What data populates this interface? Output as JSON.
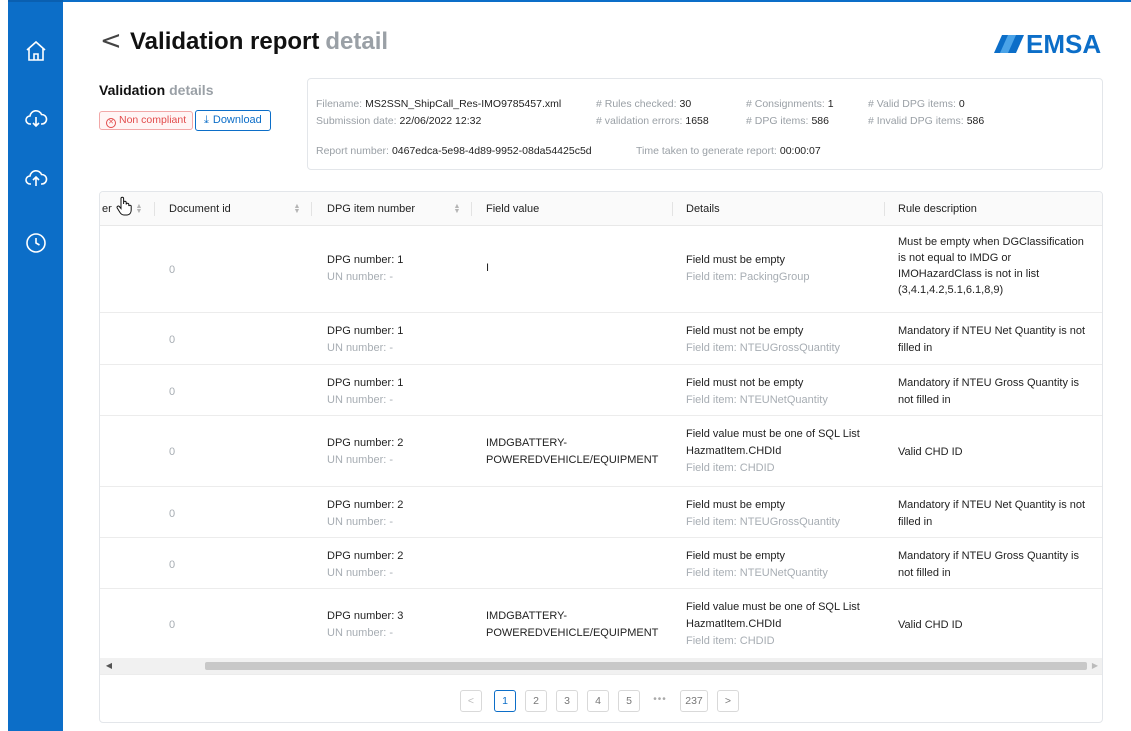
{
  "colors": {
    "brand": "#0c6ec8",
    "error": "#e24c4c",
    "muted": "#a7adb3"
  },
  "sidebar": {
    "items": [
      {
        "icon": "home-icon"
      },
      {
        "icon": "cloud-download-icon"
      },
      {
        "icon": "cloud-upload-icon"
      },
      {
        "icon": "history-icon"
      }
    ]
  },
  "header": {
    "back_icon": "chevron-left-icon",
    "title": "Validation report",
    "title_suffix": "detail",
    "logo": "EMSA"
  },
  "validation": {
    "title": "Validation",
    "title_suffix": "details",
    "status": "Non compliant",
    "status_icon": "close-circle-icon",
    "download": "Download",
    "download_icon": "download-icon"
  },
  "info": {
    "filename_label": "Filename:",
    "filename": "MS2SSN_ShipCall_Res-IMO9785457.xml",
    "submission_label": "Submission date:",
    "submission": "22/06/2022 12:32",
    "rules_label": "# Rules checked:",
    "rules": "30",
    "errors_label": "# validation errors:",
    "errors": "1658",
    "consign_label": "# Consignments:",
    "consign": "1",
    "dpg_label": "# DPG items:",
    "dpg": "586",
    "valid_label": "# Valid DPG items:",
    "valid": "0",
    "invalid_label": "# Invalid DPG items:",
    "invalid": "586",
    "report_label": "Report number:",
    "report": "0467edca-5e98-4d89-9952-08da54425c5d",
    "time_label": "Time taken to generate report:",
    "time": "00:00:07"
  },
  "table": {
    "headers": {
      "col0": "er",
      "doc": "Document id",
      "dpg": "DPG item number",
      "field": "Field value",
      "details": "Details",
      "rule": "Rule description"
    },
    "rows": [
      {
        "doc": "0",
        "dpg": "DPG number: 1",
        "un": "UN number: -",
        "field1": "I",
        "field2": "",
        "d1": "",
        "d2": "Field must be empty",
        "d3": "Field item: PackingGroup",
        "r1": "Must be empty when DGClassification",
        "r2": "is not equal to IMDG or",
        "r3": "IMOHazardClass is not in list",
        "r4": "(3,4.1,4.2,5.1,6.1,8,9)"
      },
      {
        "doc": "0",
        "dpg": "DPG number: 1",
        "un": "UN number: -",
        "field1": "",
        "field2": "",
        "d1": "",
        "d2": "Field must not be empty",
        "d3": "Field item: NTEUGrossQuantity",
        "r1": "Mandatory if NTEU Net Quantity is not",
        "r2": "filled in"
      },
      {
        "doc": "0",
        "dpg": "DPG number: 1",
        "un": "UN number: -",
        "field1": "",
        "field2": "",
        "d1": "",
        "d2": "Field must not be empty",
        "d3": "Field item: NTEUNetQuantity",
        "r1": "Mandatory if NTEU Gross Quantity is",
        "r2": "not filled in"
      },
      {
        "doc": "0",
        "dpg": "DPG number: 2",
        "un": "UN number: -",
        "field1": "IMDGBATTERY-",
        "field2": "POWEREDVEHICLE/EQUIPMENT",
        "d1": "Field value must be one of SQL List",
        "d2": "HazmatItem.CHDId",
        "d3": "Field item: CHDID",
        "r1": "Valid CHD ID",
        "r2": ""
      },
      {
        "doc": "0",
        "dpg": "DPG number: 2",
        "un": "UN number: -",
        "field1": "",
        "field2": "",
        "d1": "",
        "d2": "Field must be empty",
        "d3": "Field item: NTEUGrossQuantity",
        "r1": "Mandatory if NTEU Net Quantity is not",
        "r2": "filled in"
      },
      {
        "doc": "0",
        "dpg": "DPG number: 2",
        "un": "UN number: -",
        "field1": "",
        "field2": "",
        "d1": "",
        "d2": "Field must be empty",
        "d3": "Field item: NTEUNetQuantity",
        "r1": "Mandatory if NTEU Gross Quantity is",
        "r2": "not filled in"
      },
      {
        "doc": "0",
        "dpg": "DPG number: 3",
        "un": "UN number: -",
        "field1": "IMDGBATTERY-",
        "field2": "POWEREDVEHICLE/EQUIPMENT",
        "d1": "Field value must be one of SQL List",
        "d2": "HazmatItem.CHDId",
        "d3": "Field item: CHDID",
        "r1": "Valid CHD ID",
        "r2": ""
      }
    ]
  },
  "pagination": {
    "pages": [
      "1",
      "2",
      "3",
      "4",
      "5"
    ],
    "ellipsis": "•••",
    "last": "237",
    "prev_icon": "chevron-left-icon",
    "next_icon": "chevron-right-icon"
  }
}
